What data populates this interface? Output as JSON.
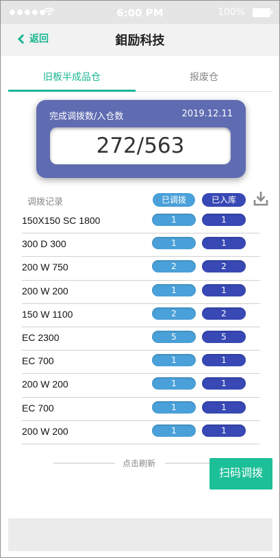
{
  "status_bar": {
    "time": "6:00 PM",
    "battery": "100%"
  },
  "navbar": {
    "back_label": "返回",
    "title": "鉬励科技"
  },
  "tabs": [
    {
      "label": "旧板半成品仓",
      "active": true
    },
    {
      "label": "报废仓",
      "active": false
    }
  ],
  "summary": {
    "label": "完成调拨数/入仓数",
    "date": "2019.12.11",
    "value": "272/563"
  },
  "records": {
    "title": "调拨记录",
    "col_transferred": "已调拨",
    "col_stored": "已入库",
    "rows": [
      {
        "name": "150X150 SC 1800",
        "transferred": "1",
        "stored": "1"
      },
      {
        "name": "300 D 300",
        "transferred": "1",
        "stored": "1"
      },
      {
        "name": "200 W 750",
        "transferred": "2",
        "stored": "2"
      },
      {
        "name": "200 W 200",
        "transferred": "1",
        "stored": "1"
      },
      {
        "name": "150 W 1100",
        "transferred": "2",
        "stored": "2"
      },
      {
        "name": "EC 2300",
        "transferred": "5",
        "stored": "5"
      },
      {
        "name": "EC 700",
        "transferred": "1",
        "stored": "1"
      },
      {
        "name": "200 W 200",
        "transferred": "1",
        "stored": "1"
      },
      {
        "name": "EC 700",
        "transferred": "1",
        "stored": "1"
      },
      {
        "name": "200 W 200",
        "transferred": "1",
        "stored": "1"
      }
    ]
  },
  "refresh_label": "点击刷新",
  "scan_button_label": "扫码调拨",
  "colors": {
    "accent": "#19b693",
    "card": "#5f6cb2",
    "transferred_pill": "#4aa0d8",
    "stored_pill": "#3848b4"
  }
}
